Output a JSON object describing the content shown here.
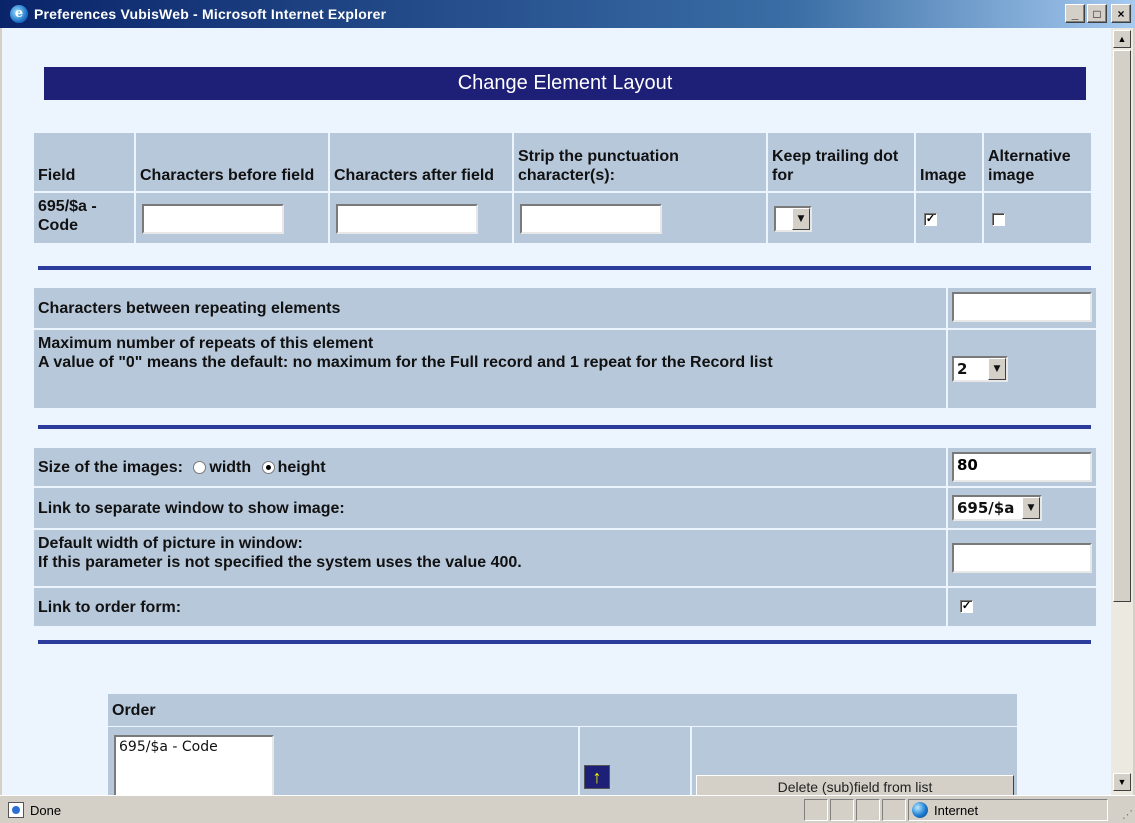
{
  "window": {
    "title": "Preferences VubisWeb - Microsoft Internet Explorer",
    "minimize": "_",
    "maximize": "□",
    "close": "×"
  },
  "page": {
    "title": "Change Element Layout"
  },
  "field_table": {
    "headers": {
      "field": "Field",
      "before": "Characters before field",
      "after": "Characters after field",
      "strip": "Strip the punctuation character(s):",
      "keep_dot": "Keep trailing dot for",
      "image": "Image",
      "alt_image": "Alternative image"
    },
    "row": {
      "field": "695/$a - Code",
      "before": "",
      "after": "",
      "strip": "",
      "keep_dot": "",
      "image_checked": true,
      "alt_image_checked": false
    }
  },
  "repeat_section": {
    "between_label": "Characters between repeating elements",
    "between_value": "",
    "max_label": "Maximum number of repeats of this element",
    "max_note": "A value of \"0\" means the default: no maximum for the Full record and 1 repeat for the Record list",
    "max_value": "2"
  },
  "image_section": {
    "size_label": "Size of the images:",
    "width_label": "width",
    "height_label": "height",
    "size_mode": "height",
    "size_value": "80",
    "link_label": "Link to separate window to show image:",
    "link_value": "695/$a",
    "default_width_label": "Default width of picture in window:",
    "default_width_note": "If this parameter is not specified the system uses the value 400.",
    "default_width_value": "",
    "order_form_label": "Link to order form:",
    "order_form_checked": true
  },
  "order_section": {
    "header": "Order",
    "items": [
      "695/$a - Code"
    ],
    "up_button": "↑",
    "delete_button": "Delete (sub)field from list"
  },
  "statusbar": {
    "status": "Done",
    "zone": "Internet"
  },
  "colors": {
    "header_bg": "#1e1f77",
    "cell_bg": "#b7c8db",
    "page_bg": "#ecf5fd",
    "rule": "#2c3c9c"
  }
}
